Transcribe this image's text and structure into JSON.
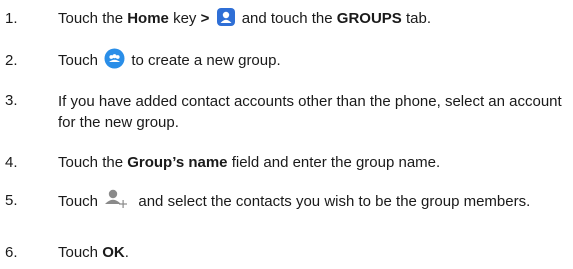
{
  "steps": [
    {
      "number": "1.",
      "segments": [
        {
          "text": "Touch the ",
          "bold": false
        },
        {
          "text": "Home",
          "bold": true
        },
        {
          "text": " key ",
          "bold": false
        },
        {
          "text": ">",
          "bold": true
        },
        {
          "icon": "contacts-app-icon"
        },
        {
          "text": " and touch the ",
          "bold": false
        },
        {
          "text": "GROUPS",
          "bold": true
        },
        {
          "text": " tab.",
          "bold": false
        }
      ]
    },
    {
      "number": "2.",
      "segments": [
        {
          "text": "Touch ",
          "bold": false
        },
        {
          "icon": "new-group-button-icon"
        },
        {
          "text": " to create a new group.",
          "bold": false
        }
      ]
    },
    {
      "number": "3.",
      "segments": [
        {
          "text": "If you have added contact accounts other than the phone, select an account for the new group.",
          "bold": false
        }
      ]
    },
    {
      "number": "4.",
      "segments": [
        {
          "text": "Touch the ",
          "bold": false
        },
        {
          "text": "Group’s name",
          "bold": true
        },
        {
          "text": " field and enter the group name.",
          "bold": false
        }
      ]
    },
    {
      "number": "5.",
      "segments": [
        {
          "text": "Touch ",
          "bold": false
        },
        {
          "icon": "add-member-icon"
        },
        {
          "text": " and select the contacts you wish to be the group members.",
          "bold": false
        }
      ]
    },
    {
      "number": "6.",
      "segments": [
        {
          "text": "Touch ",
          "bold": false
        },
        {
          "text": "OK",
          "bold": true
        },
        {
          "text": ".",
          "bold": false
        }
      ]
    }
  ],
  "colors": {
    "text": "#1a1a1a",
    "contacts_icon_blue": "#2f6fd6",
    "fab_blue": "#2a8ee8",
    "add_member_gray": "#8a8a8a"
  }
}
